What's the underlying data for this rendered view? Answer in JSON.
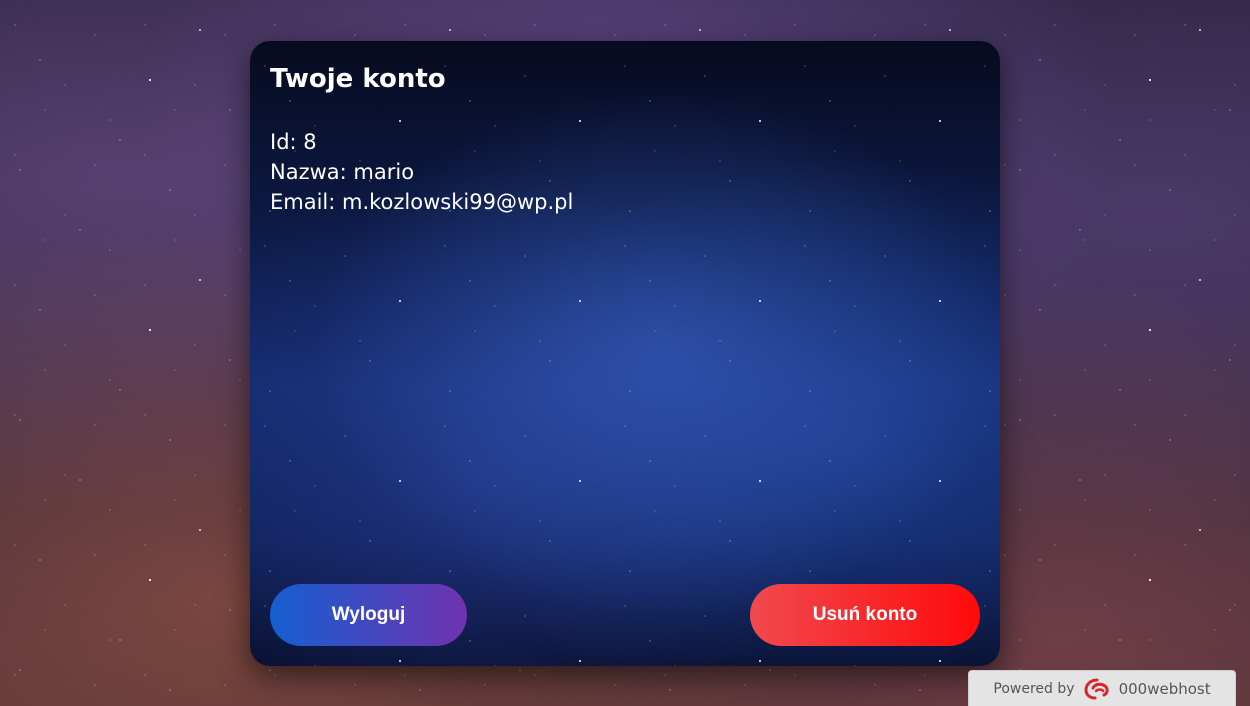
{
  "account": {
    "title": "Twoje konto",
    "id_line": "Id: 8",
    "name_line": "Nazwa: mario",
    "email_line": "Email: m.kozlowski99@wp.pl"
  },
  "buttons": {
    "logout": "Wyloguj",
    "delete_account": "Usuń konto"
  },
  "footer": {
    "powered_by": "Powered by",
    "brand": "000webhost"
  },
  "colors": {
    "logout_gradient": [
      "#155fd0",
      "#7032b0"
    ],
    "delete_gradient": [
      "#f04a4f",
      "#ff0a0a"
    ],
    "brand_logo": "#d9262c"
  },
  "icons": {
    "brand_logo": "000webhost-logo-icon"
  }
}
